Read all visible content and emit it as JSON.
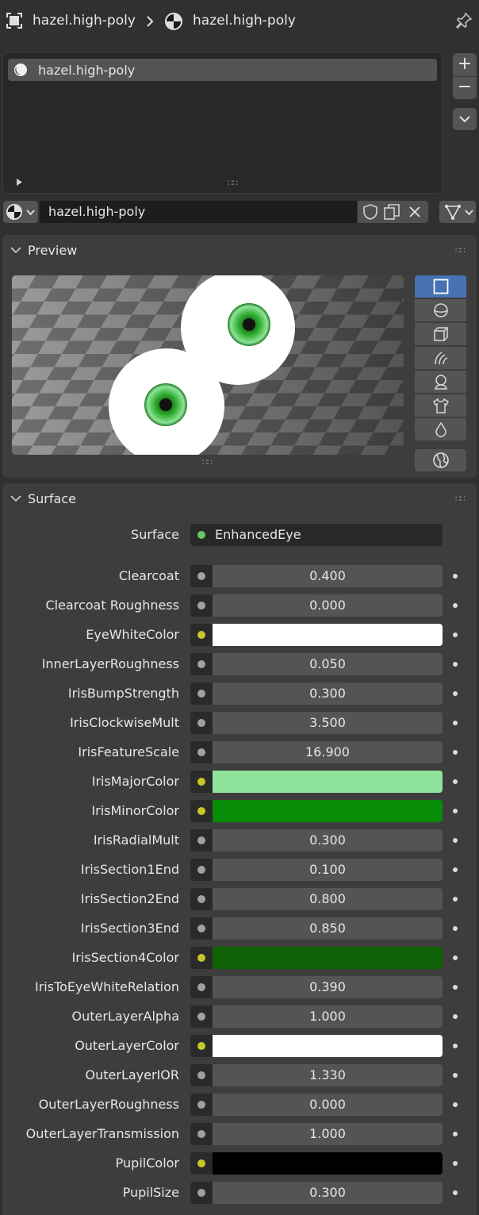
{
  "header": {
    "object_name": "hazel.high-poly",
    "material_name": "hazel.high-poly"
  },
  "material_slots": {
    "items": [
      {
        "label": "hazel.high-poly"
      }
    ],
    "add_symbol": "+",
    "remove_symbol": "−"
  },
  "data_block": {
    "material_name": "hazel.high-poly"
  },
  "preview": {
    "title": "Preview",
    "shapes": [
      "flat-icon",
      "sphere-icon",
      "cube-icon",
      "hair-icon",
      "monkey-icon",
      "cloth-icon",
      "fluid-icon"
    ],
    "selected_shape": "flat-icon"
  },
  "surface": {
    "title": "Surface",
    "surface_label": "Surface",
    "surface_value": "EnhancedEye",
    "properties": [
      {
        "label": "Clearcoat",
        "value": "0.400"
      },
      {
        "label": "Clearcoat Roughness",
        "value": "0.000"
      },
      {
        "label": "EyeWhiteColor",
        "color": "#ffffff"
      },
      {
        "label": "InnerLayerRoughness",
        "value": "0.050"
      },
      {
        "label": "IrisBumpStrength",
        "value": "0.300"
      },
      {
        "label": "IrisClockwiseMult",
        "value": "3.500"
      },
      {
        "label": "IrisFeatureScale",
        "value": "16.900"
      },
      {
        "label": "IrisMajorColor",
        "color": "#8fe39b"
      },
      {
        "label": "IrisMinorColor",
        "color": "#078c07"
      },
      {
        "label": "IrisRadialMult",
        "value": "0.300"
      },
      {
        "label": "IrisSection1End",
        "value": "0.100"
      },
      {
        "label": "IrisSection2End",
        "value": "0.800"
      },
      {
        "label": "IrisSection3End",
        "value": "0.850"
      },
      {
        "label": "IrisSection4Color",
        "color": "#0f6306"
      },
      {
        "label": "IrisToEyeWhiteRelation",
        "value": "0.390"
      },
      {
        "label": "OuterLayerAlpha",
        "value": "1.000"
      },
      {
        "label": "OuterLayerColor",
        "color": "#ffffff"
      },
      {
        "label": "OuterLayerIOR",
        "value": "1.330"
      },
      {
        "label": "OuterLayerRoughness",
        "value": "0.000"
      },
      {
        "label": "OuterLayerTransmission",
        "value": "1.000"
      },
      {
        "label": "PupilColor",
        "color": "#000000"
      },
      {
        "label": "PupilSize",
        "value": "0.300"
      }
    ]
  },
  "colors": {
    "float_socket": "#a1a1a1",
    "color_socket": "#c7c729",
    "shader_socket": "#63c763",
    "accent": "#4772b3"
  }
}
